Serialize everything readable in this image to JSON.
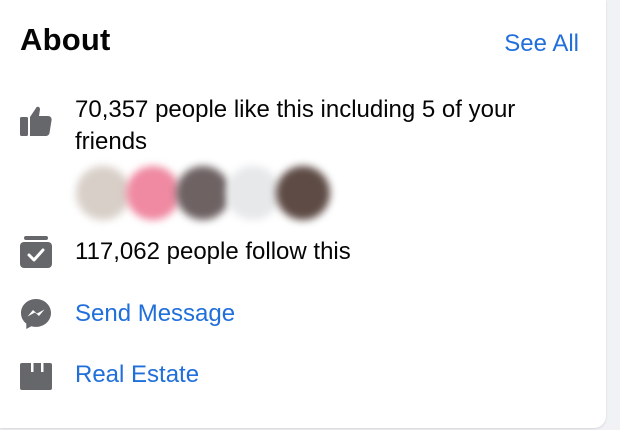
{
  "about": {
    "title": "About",
    "see_all": "See All"
  },
  "likes": {
    "icon": "thumbs-up-icon",
    "text": "70,357 people like this including 5 of your friends"
  },
  "friend_avatars": [
    {
      "name": "friend-avatar-1",
      "color": "#d8cfc8"
    },
    {
      "name": "friend-avatar-2",
      "color": "#ef8aa2"
    },
    {
      "name": "friend-avatar-3",
      "color": "#6e6263"
    },
    {
      "name": "friend-avatar-4",
      "color": "#e6e8ea"
    },
    {
      "name": "friend-avatar-5",
      "color": "#5e4b45"
    }
  ],
  "follows": {
    "icon": "follow-checkmark-icon",
    "text": "117,062 people follow this"
  },
  "message": {
    "icon": "messenger-icon",
    "text": "Send Message"
  },
  "category": {
    "icon": "category-icon",
    "text": "Real Estate"
  },
  "colors": {
    "link": "#216fdb",
    "icon": "#65676b",
    "text": "#050505"
  }
}
